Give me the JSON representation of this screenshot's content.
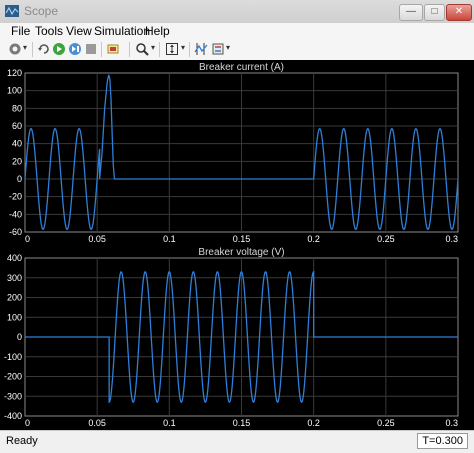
{
  "window": {
    "title": "Scope",
    "minimize_glyph": "—",
    "maximize_glyph": "□",
    "close_glyph": "✕"
  },
  "menu": [
    "File",
    "Tools",
    "View",
    "Simulation",
    "Help"
  ],
  "toolbar": {
    "icons": [
      "settings-icon",
      "restore-icon",
      "run-icon",
      "step-forward-icon",
      "stop-icon",
      "zoom-icon",
      "autoscale-icon",
      "cursor-measure-icon"
    ],
    "dropdown_glyph": "▾"
  },
  "colors": {
    "trace": "#2f7fd8",
    "background": "#000000",
    "grid": "#3a3a3a",
    "axis_text": "#ffffff",
    "title_text": "#d8d8d8"
  },
  "status": {
    "text": "Ready",
    "time": "T=0.300"
  },
  "chart_data": [
    {
      "type": "line",
      "title": "Breaker current (A)",
      "xlim": [
        0,
        0.3
      ],
      "ylim": [
        -60,
        120
      ],
      "xticks": [
        "0",
        "0.05",
        "0.1",
        "0.15",
        "0.2",
        "0.25",
        "0.3"
      ],
      "yticks": [
        "-60",
        "-40",
        "-20",
        "0",
        "20",
        "40",
        "60",
        "80",
        "100",
        "120"
      ],
      "grid": true,
      "series": [
        {
          "segments": [
            {
              "kind": "sine",
              "x0": 0,
              "x1": 0.0517,
              "amp": 57,
              "freq": 60,
              "phase": 0
            },
            {
              "kind": "points",
              "points": [
                [
                  0.0517,
                  0
                ],
                [
                  0.0534,
                  30
                ],
                [
                  0.0552,
                  80
                ],
                [
                  0.057,
                  110
                ],
                [
                  0.058,
                  118
                ],
                [
                  0.0588,
                  113
                ],
                [
                  0.0596,
                  90
                ],
                [
                  0.0604,
                  50
                ],
                [
                  0.0612,
                  15
                ],
                [
                  0.062,
                  0
                ]
              ]
            },
            {
              "kind": "flat",
              "x0": 0.062,
              "x1": 0.2,
              "value": 0
            },
            {
              "kind": "sine",
              "x0": 0.2,
              "x1": 0.3,
              "amp": 57,
              "freq": 60,
              "phase": 0
            }
          ]
        }
      ]
    },
    {
      "type": "line",
      "title": "Breaker voltage (V)",
      "xlim": [
        0,
        0.3
      ],
      "ylim": [
        -400,
        400
      ],
      "xticks": [
        "0",
        "0.05",
        "0.1",
        "0.15",
        "0.2",
        "0.25",
        "0.3"
      ],
      "yticks": [
        "-400",
        "-300",
        "-200",
        "-100",
        "0",
        "100",
        "200",
        "300",
        "400"
      ],
      "grid": true,
      "series": [
        {
          "segments": [
            {
              "kind": "flat",
              "x0": 0,
              "x1": 0.0583,
              "value": 0
            },
            {
              "kind": "sine",
              "x0": 0.0583,
              "x1": 0.2,
              "amp": 330,
              "freq": 60,
              "phase": -1.5708
            },
            {
              "kind": "flat",
              "x0": 0.2,
              "x1": 0.3,
              "value": 0
            }
          ]
        }
      ]
    }
  ]
}
